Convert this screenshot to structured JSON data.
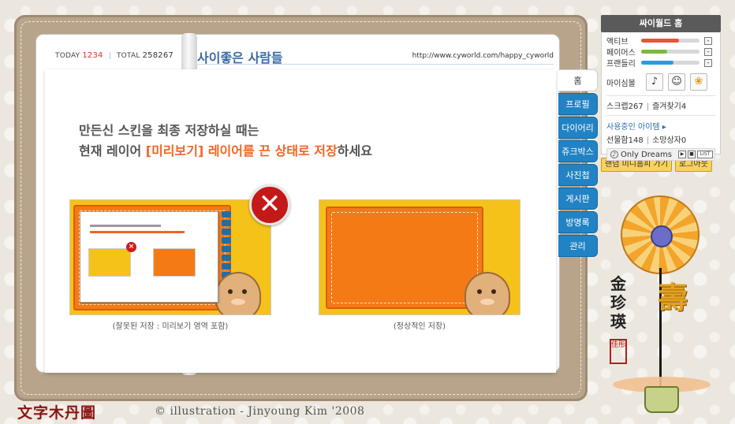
{
  "counter": {
    "today_label": "TODAY",
    "today_value": "1234",
    "total_label": "TOTAL",
    "total_value": "258267"
  },
  "header": {
    "title": "사이좋은 사람들",
    "url": "http://www.cyworld.com/happy_cyworld"
  },
  "notice": {
    "line1": "만든신 스킨을 최종 저장하실 때는",
    "line2_pre": "현재 레이어 ",
    "line2_accent": "[미리보기] 레이어를 끈 상태로 저장",
    "line2_post": "하세요",
    "wrong_caption": "(잘못된 저장 : 미리보기 영역 포함)",
    "right_caption": "(정상적인 저장)"
  },
  "tabs": [
    "홈",
    "프로필",
    "다이어리",
    "쥬크박스",
    "사진첩",
    "게시판",
    "방명록",
    "관리"
  ],
  "side": {
    "title": "싸이월드 홈",
    "stats": [
      {
        "label": "액티브",
        "level": 0.65,
        "color": "#e5553a"
      },
      {
        "label": "페이머스",
        "level": 0.45,
        "color": "#7db93c"
      },
      {
        "label": "프랜들리",
        "level": 0.55,
        "color": "#2e9bd8"
      }
    ],
    "minime_label": "마이심볼",
    "minime_icons": [
      "music-note-icon",
      "person-icon",
      "fish-icon"
    ],
    "scrap": "스크랩267",
    "favorites": "즐겨찾기4",
    "items_link": "사용중인 아이템 ▸",
    "gift": "선물함148",
    "wish": "소망상자0",
    "bgm_title": "Only Dreams",
    "bgm_list": "LIST",
    "random_btn": "랜덤 미니홈피 가기",
    "logout_btn": "로그아웃"
  },
  "art": {
    "calligraphy": "金珍瑛",
    "seal": "佳彤",
    "big_char": "壽"
  },
  "footer": {
    "signature": "文字木丹圖",
    "credit": "© illustration - Jinyoung Kim '2008"
  }
}
